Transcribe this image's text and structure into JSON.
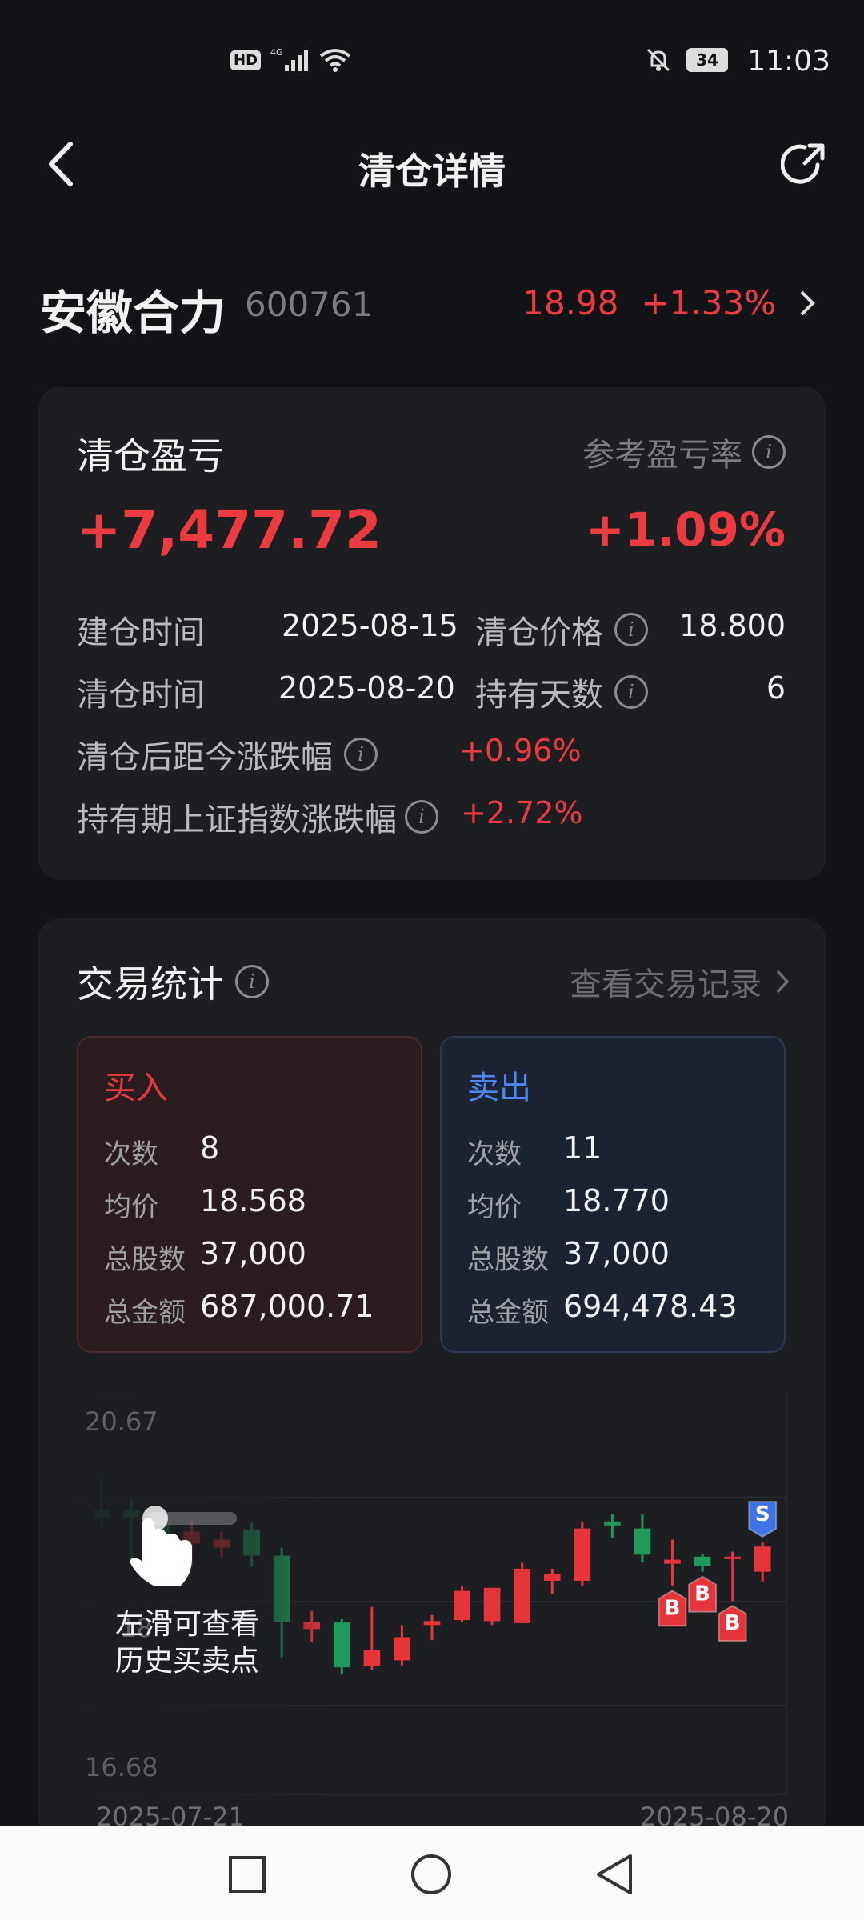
{
  "status_bar": {
    "time": "11:03",
    "battery": "34"
  },
  "nav": {
    "title": "清仓详情"
  },
  "stock": {
    "name": "安徽合力",
    "code": "600761",
    "price": "18.98",
    "change": "+1.33%"
  },
  "summary": {
    "title": "清仓盈亏",
    "ref_label": "参考盈亏率",
    "profit": "+7,477.72",
    "profit_rate": "+1.09%",
    "rows": {
      "open_time_label": "建仓时间",
      "open_time": "2025-08-15",
      "close_price_label": "清仓价格",
      "close_price": "18.800",
      "close_time_label": "清仓时间",
      "close_time": "2025-08-20",
      "hold_days_label": "持有天数",
      "hold_days": "6",
      "after_change_label": "清仓后距今涨跌幅",
      "after_change": "+0.96%",
      "index_change_label": "持有期上证指数涨跌幅",
      "index_change": "+2.72%"
    }
  },
  "trade": {
    "title": "交易统计",
    "record_link": "查看交易记录",
    "buy": {
      "title": "买入",
      "count_label": "次数",
      "count": "8",
      "avg_label": "均价",
      "avg": "18.568",
      "shares_label": "总股数",
      "shares": "37,000",
      "amount_label": "总金额",
      "amount": "687,000.71"
    },
    "sell": {
      "title": "卖出",
      "count_label": "次数",
      "count": "11",
      "avg_label": "均价",
      "avg": "18.770",
      "shares_label": "总股数",
      "shares": "37,000",
      "amount_label": "总金额",
      "amount": "694,478.43"
    }
  },
  "chart": {
    "y_top": "20.67",
    "y_mid": "18",
    "y_bottom": "16.68",
    "x_start": "2025-07-21",
    "x_end": "2025-08-20",
    "hint_line1": "左滑可查看",
    "hint_line2": "历史买卖点",
    "buy_marker": "B",
    "sell_marker": "S",
    "colors": {
      "up": "#e6343b",
      "down": "#1f9a5c",
      "sell": "#3f73e6"
    }
  },
  "chart_data": {
    "type": "candlestick",
    "x_range": [
      "2025-07-21",
      "2025-08-20"
    ],
    "ylim": [
      16.68,
      20.67
    ],
    "candles": [
      {
        "o": 19.52,
        "h": 19.85,
        "l": 19.35,
        "c": 19.43
      },
      {
        "o": 19.51,
        "h": 19.62,
        "l": 19.02,
        "c": 19.44
      },
      {
        "o": 19.37,
        "h": 19.45,
        "l": 19.05,
        "c": 19.25
      },
      {
        "o": 19.18,
        "h": 19.4,
        "l": 18.95,
        "c": 19.3
      },
      {
        "o": 19.14,
        "h": 19.3,
        "l": 19.05,
        "c": 19.22
      },
      {
        "o": 19.32,
        "h": 19.39,
        "l": 18.95,
        "c": 19.06
      },
      {
        "o": 19.06,
        "h": 19.14,
        "l": 18.05,
        "c": 18.4
      },
      {
        "o": 18.33,
        "h": 18.51,
        "l": 18.2,
        "c": 18.4
      },
      {
        "o": 18.4,
        "h": 18.43,
        "l": 17.88,
        "c": 17.95
      },
      {
        "o": 17.96,
        "h": 18.55,
        "l": 17.92,
        "c": 18.12
      },
      {
        "o": 18.02,
        "h": 18.37,
        "l": 17.97,
        "c": 18.25
      },
      {
        "o": 18.37,
        "h": 18.47,
        "l": 18.22,
        "c": 18.41
      },
      {
        "o": 18.42,
        "h": 18.76,
        "l": 18.4,
        "c": 18.71
      },
      {
        "o": 18.41,
        "h": 18.74,
        "l": 18.37,
        "c": 18.74
      },
      {
        "o": 18.39,
        "h": 18.99,
        "l": 18.39,
        "c": 18.93
      },
      {
        "o": 18.81,
        "h": 18.93,
        "l": 18.68,
        "c": 18.88
      },
      {
        "o": 18.81,
        "h": 19.4,
        "l": 18.76,
        "c": 19.33
      },
      {
        "o": 19.4,
        "h": 19.47,
        "l": 19.24,
        "c": 19.36
      },
      {
        "o": 19.33,
        "h": 19.47,
        "l": 19.0,
        "c": 19.07
      },
      {
        "o": 18.98,
        "h": 19.22,
        "l": 18.76,
        "c": 19.02
      },
      {
        "o": 19.05,
        "h": 19.08,
        "l": 18.9,
        "c": 18.96
      },
      {
        "o": 19.03,
        "h": 19.1,
        "l": 18.61,
        "c": 19.05
      },
      {
        "o": 18.9,
        "h": 19.2,
        "l": 18.8,
        "c": 19.15
      }
    ],
    "markers": [
      {
        "index": 19,
        "type": "B"
      },
      {
        "index": 20,
        "type": "B"
      },
      {
        "index": 21,
        "type": "B"
      },
      {
        "index": 22,
        "type": "S"
      }
    ]
  }
}
